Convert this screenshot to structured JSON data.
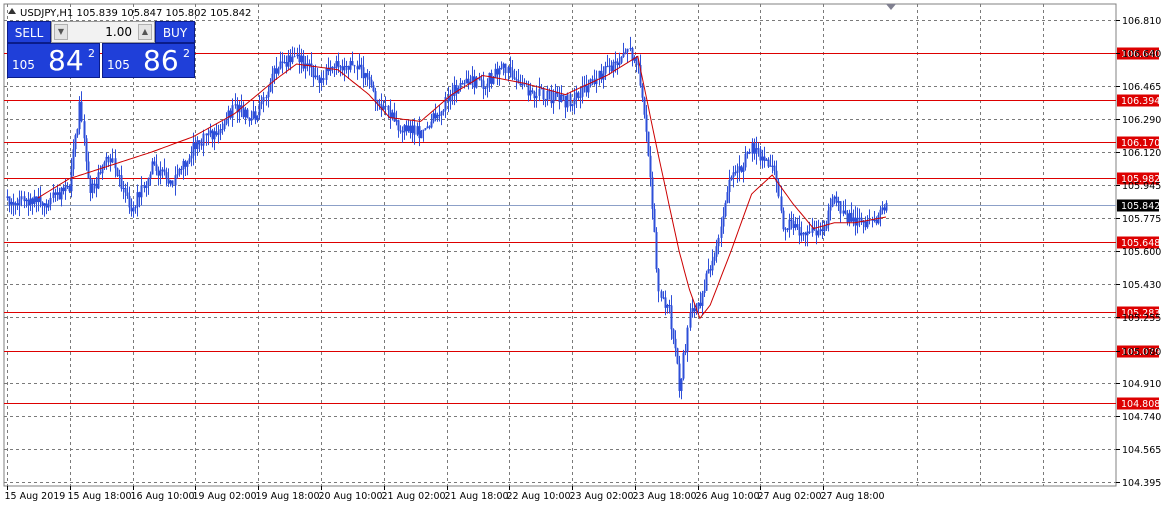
{
  "header": {
    "symbol_info": "USDJPY,H1  105.839 105.847 105.802 105.842"
  },
  "trade_panel": {
    "sell_label": "SELL",
    "buy_label": "BUY",
    "lot": "1.00",
    "sell_price": {
      "big": "105",
      "pips": "84",
      "point": "2"
    },
    "buy_price": {
      "big": "105",
      "pips": "86",
      "point": "2"
    }
  },
  "colors": {
    "candles": "#2e4fd8",
    "moving_average": "#cc0000",
    "levels": "#dd0000",
    "grid": "#7a7a7a",
    "current_price_line": "#8ca0c8"
  },
  "chart_data": {
    "type": "line",
    "style": "candlestick",
    "symbol": "USDJPY",
    "timeframe": "H1",
    "grid": true,
    "ylim": [
      104.395,
      106.81
    ],
    "y_ticks": [
      "106.810",
      "106.640",
      "106.465",
      "106.290",
      "106.120",
      "105.945",
      "105.775",
      "105.600",
      "105.430",
      "105.255",
      "105.080",
      "104.910",
      "104.740",
      "104.565",
      "104.395"
    ],
    "x_labels": [
      "15 Aug 2019",
      "15 Aug 18:00",
      "16 Aug 10:00",
      "19 Aug 02:00",
      "19 Aug 18:00",
      "20 Aug 10:00",
      "21 Aug 02:00",
      "21 Aug 18:00",
      "22 Aug 10:00",
      "23 Aug 02:00",
      "23 Aug 18:00",
      "26 Aug 10:00",
      "27 Aug 02:00",
      "27 Aug 18:00"
    ],
    "levels": [
      {
        "label": "106.640",
        "value": 106.64
      },
      {
        "label": "106.394",
        "value": 106.394
      },
      {
        "label": "106.170",
        "value": 106.17
      },
      {
        "label": "105.982",
        "value": 105.982
      },
      {
        "label": "105.648",
        "value": 105.648
      },
      {
        "label": "105.283",
        "value": 105.283
      },
      {
        "label": "105.079",
        "value": 105.079
      },
      {
        "label": "104.808",
        "value": 104.808
      }
    ],
    "current_price": {
      "label": "105.842",
      "value": 105.842
    },
    "price_path": [
      [
        0,
        105.88
      ],
      [
        4,
        105.86
      ],
      [
        6,
        105.95
      ],
      [
        7,
        106.35
      ],
      [
        8,
        105.9
      ],
      [
        10,
        106.1
      ],
      [
        12,
        105.82
      ],
      [
        14,
        106.05
      ],
      [
        16,
        105.95
      ],
      [
        18,
        106.15
      ],
      [
        20,
        106.22
      ],
      [
        22,
        106.35
      ],
      [
        24,
        106.3
      ],
      [
        26,
        106.55
      ],
      [
        28,
        106.62
      ],
      [
        30,
        106.5
      ],
      [
        32,
        106.58
      ],
      [
        34,
        106.55
      ],
      [
        36,
        106.38
      ],
      [
        38,
        106.25
      ],
      [
        40,
        106.22
      ],
      [
        42,
        106.35
      ],
      [
        44,
        106.5
      ],
      [
        46,
        106.48
      ],
      [
        48,
        106.55
      ],
      [
        50,
        106.45
      ],
      [
        52,
        106.42
      ],
      [
        54,
        106.38
      ],
      [
        56,
        106.45
      ],
      [
        58,
        106.55
      ],
      [
        60,
        106.65
      ],
      [
        61,
        106.6
      ],
      [
        62,
        106.1
      ],
      [
        63,
        105.4
      ],
      [
        64,
        105.3
      ],
      [
        65,
        104.9
      ],
      [
        66,
        105.25
      ],
      [
        67,
        105.35
      ],
      [
        69,
        105.7
      ],
      [
        70,
        106.0
      ],
      [
        71,
        106.05
      ],
      [
        72,
        106.15
      ],
      [
        73,
        106.1
      ],
      [
        74,
        106.05
      ],
      [
        75,
        105.75
      ],
      [
        77,
        105.7
      ],
      [
        79,
        105.72
      ],
      [
        80,
        105.9
      ],
      [
        81,
        105.78
      ],
      [
        83,
        105.75
      ],
      [
        84,
        105.78
      ],
      [
        85,
        105.842
      ]
    ],
    "ma_path": [
      [
        3,
        105.88
      ],
      [
        6,
        105.98
      ],
      [
        10,
        106.05
      ],
      [
        14,
        106.12
      ],
      [
        18,
        106.2
      ],
      [
        22,
        106.32
      ],
      [
        26,
        106.5
      ],
      [
        28,
        106.58
      ],
      [
        32,
        106.55
      ],
      [
        35,
        106.42
      ],
      [
        37,
        106.3
      ],
      [
        40,
        106.28
      ],
      [
        43,
        106.42
      ],
      [
        46,
        106.52
      ],
      [
        50,
        106.48
      ],
      [
        54,
        106.42
      ],
      [
        58,
        106.52
      ],
      [
        61,
        106.62
      ],
      [
        63,
        106.1
      ],
      [
        65,
        105.6
      ],
      [
        66,
        105.4
      ],
      [
        67,
        105.25
      ],
      [
        68,
        105.32
      ],
      [
        70,
        105.6
      ],
      [
        72,
        105.9
      ],
      [
        74,
        106.0
      ],
      [
        76,
        105.85
      ],
      [
        78,
        105.72
      ],
      [
        80,
        105.75
      ],
      [
        82,
        105.75
      ],
      [
        85,
        105.78
      ]
    ]
  }
}
